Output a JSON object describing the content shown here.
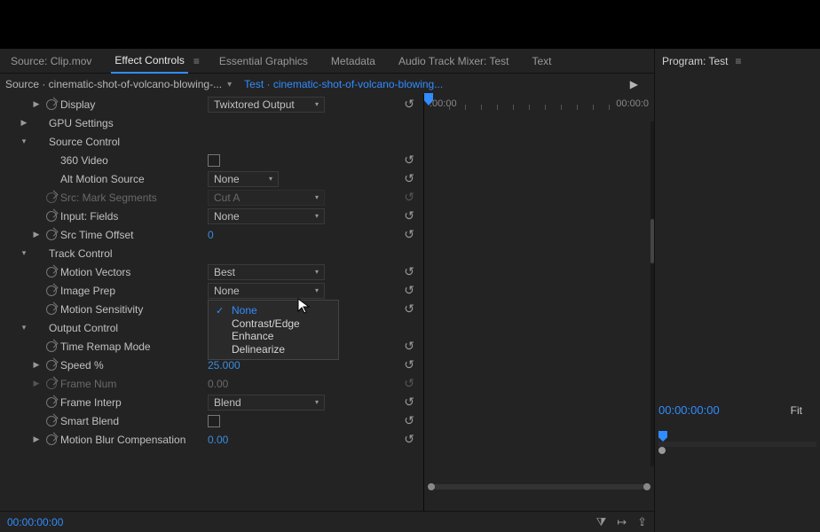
{
  "tabs": {
    "source": "Source: Clip.mov",
    "effect_controls": "Effect Controls",
    "essential_graphics": "Essential Graphics",
    "metadata": "Metadata",
    "audio_mixer": "Audio Track Mixer: Test",
    "text": "Text"
  },
  "program_header": "Program: Test",
  "breadcrumb": {
    "source": "Source · cinematic-shot-of-volcano-blowing-...",
    "sequence": "Test · cinematic-shot-of-volcano-blowing..."
  },
  "ruler": {
    "start": ":00:00",
    "end": "00:00:0"
  },
  "display": {
    "label": "Display",
    "value": "Twixtored Output"
  },
  "gpu_settings": "GPU Settings",
  "source_control": {
    "label": "Source Control",
    "video_360": "360 Video",
    "alt_motion_source": {
      "label": "Alt Motion Source",
      "value": "None"
    },
    "src_mark_segments": {
      "label": "Src: Mark Segments",
      "value": "Cut A"
    },
    "input_fields": {
      "label": "Input: Fields",
      "value": "None"
    },
    "src_time_offset": {
      "label": "Src Time Offset",
      "value": "0"
    }
  },
  "track_control": {
    "label": "Track Control",
    "motion_vectors": {
      "label": "Motion Vectors",
      "value": "Best"
    },
    "image_prep": {
      "label": "Image Prep",
      "value": "None",
      "options": [
        "None",
        "Contrast/Edge Enhance",
        "Delinearize"
      ]
    },
    "motion_sensitivity": "Motion Sensitivity"
  },
  "output_control": {
    "label": "Output Control",
    "time_remap_mode": "Time Remap Mode",
    "speed": {
      "label": "Speed %",
      "value": "25.000"
    },
    "frame_num": {
      "label": "Frame Num",
      "value": "0.00"
    },
    "frame_interp": {
      "label": "Frame Interp",
      "value": "Blend"
    },
    "smart_blend": "Smart Blend",
    "motion_blur_comp": {
      "label": "Motion Blur Compensation",
      "value": "0.00"
    }
  },
  "footer_tc": "00:00:00:00",
  "program": {
    "tc": "00:00:00:00",
    "fit": "Fit"
  }
}
